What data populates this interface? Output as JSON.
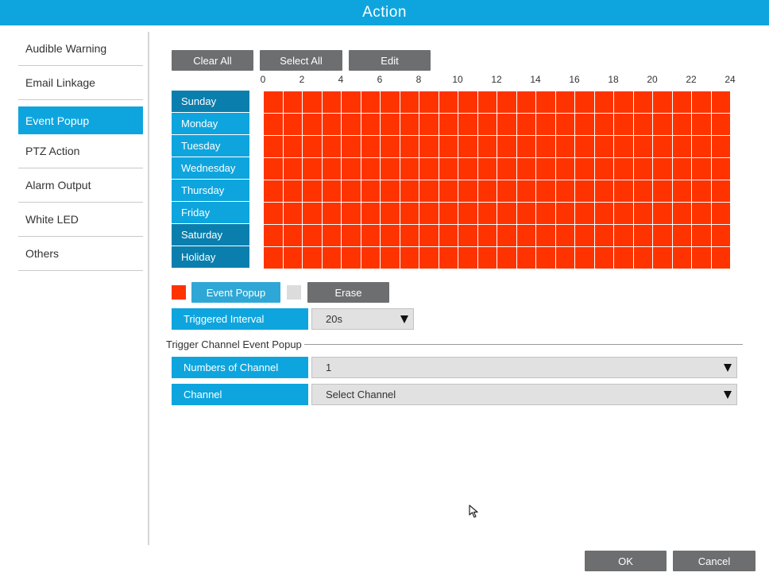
{
  "window": {
    "title": "Action"
  },
  "sidebar": {
    "items": [
      {
        "label": "Audible Warning",
        "active": false
      },
      {
        "label": "Email Linkage",
        "active": false
      },
      {
        "label": "Event Popup",
        "active": true
      },
      {
        "label": "PTZ Action",
        "active": false
      },
      {
        "label": "Alarm Output",
        "active": false
      },
      {
        "label": "White LED",
        "active": false
      },
      {
        "label": "Others",
        "active": false
      }
    ]
  },
  "toolbar": {
    "clear_all": "Clear All",
    "select_all": "Select All",
    "edit": "Edit"
  },
  "schedule": {
    "hours": [
      "0",
      "2",
      "4",
      "6",
      "8",
      "10",
      "12",
      "14",
      "16",
      "18",
      "20",
      "22",
      "24"
    ],
    "days": [
      {
        "label": "Sunday",
        "dark": true
      },
      {
        "label": "Monday",
        "dark": false
      },
      {
        "label": "Tuesday",
        "dark": false
      },
      {
        "label": "Wednesday",
        "dark": false
      },
      {
        "label": "Thursday",
        "dark": false
      },
      {
        "label": "Friday",
        "dark": false
      },
      {
        "label": "Saturday",
        "dark": true
      },
      {
        "label": "Holiday",
        "dark": true
      }
    ],
    "slots_per_day": 24,
    "fill_color": "#ff3300"
  },
  "legend": {
    "event_popup_label": "Event Popup",
    "event_popup_color": "#ff3300",
    "erase_label": "Erase",
    "erase_color": "#dcdcdc"
  },
  "triggered_interval": {
    "label": "Triggered Interval",
    "value": "20s"
  },
  "trigger_channel": {
    "section_title": "Trigger Channel Event Popup",
    "numbers_label": "Numbers of Channel",
    "numbers_value": "1",
    "channel_label": "Channel",
    "channel_value": "Select Channel"
  },
  "footer": {
    "ok": "OK",
    "cancel": "Cancel"
  },
  "colors": {
    "accent": "#0ea5de",
    "accent_dark": "#0a7fae",
    "button": "#6d6e70"
  }
}
